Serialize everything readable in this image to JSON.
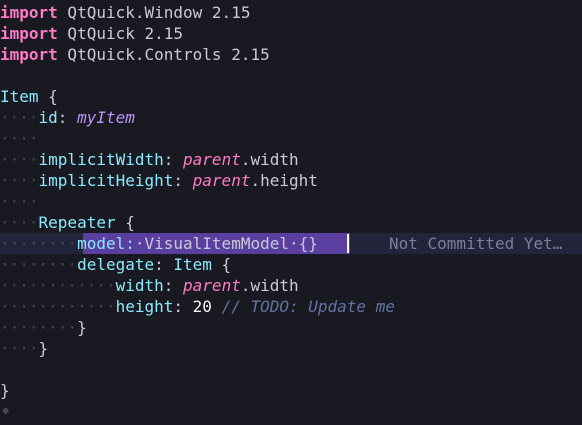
{
  "lines": [
    {
      "tokens": [
        {
          "c": "kw",
          "t": "import"
        },
        {
          "c": "plain",
          "t": " QtQuick.Window 2.15"
        }
      ]
    },
    {
      "tokens": [
        {
          "c": "kw",
          "t": "import"
        },
        {
          "c": "plain",
          "t": " QtQuick 2.15"
        }
      ]
    },
    {
      "tokens": [
        {
          "c": "kw",
          "t": "import"
        },
        {
          "c": "plain",
          "t": " QtQuick.Controls 2.15"
        }
      ]
    },
    {
      "tokens": []
    },
    {
      "tokens": [
        {
          "c": "type",
          "t": "Item"
        },
        {
          "c": "plain",
          "t": " {"
        }
      ]
    },
    {
      "tokens": [
        {
          "c": "guide-dot",
          "t": "····"
        },
        {
          "c": "prop",
          "t": "id"
        },
        {
          "c": "plain",
          "t": ": "
        },
        {
          "c": "id",
          "t": "myItem"
        }
      ]
    },
    {
      "tokens": [
        {
          "c": "guide-dot",
          "t": "····"
        }
      ]
    },
    {
      "tokens": [
        {
          "c": "guide-dot",
          "t": "····"
        },
        {
          "c": "prop",
          "t": "implicitWidth"
        },
        {
          "c": "plain",
          "t": ": "
        },
        {
          "c": "val",
          "t": "parent"
        },
        {
          "c": "plain",
          "t": ".width"
        }
      ]
    },
    {
      "tokens": [
        {
          "c": "guide-dot",
          "t": "····"
        },
        {
          "c": "prop",
          "t": "implicitHeight"
        },
        {
          "c": "plain",
          "t": ": "
        },
        {
          "c": "val",
          "t": "parent"
        },
        {
          "c": "plain",
          "t": ".height"
        }
      ]
    },
    {
      "tokens": [
        {
          "c": "guide-dot",
          "t": "····"
        }
      ]
    },
    {
      "tokens": [
        {
          "c": "guide-dot",
          "t": "····"
        },
        {
          "c": "type",
          "t": "Repeater"
        },
        {
          "c": "plain",
          "t": " {"
        }
      ]
    },
    {
      "tokens": [
        {
          "c": "guide-dot",
          "t": "········"
        },
        {
          "c": "prop",
          "t": "model:"
        },
        {
          "c": "plain",
          "t": "·VisualItemModel·{}"
        }
      ]
    },
    {
      "tokens": [
        {
          "c": "guide-dot",
          "t": "········"
        },
        {
          "c": "prop",
          "t": "delegate"
        },
        {
          "c": "plain",
          "t": ": "
        },
        {
          "c": "type",
          "t": "Item"
        },
        {
          "c": "plain",
          "t": " {"
        }
      ]
    },
    {
      "tokens": [
        {
          "c": "guide-dot",
          "t": "············"
        },
        {
          "c": "prop",
          "t": "width"
        },
        {
          "c": "plain",
          "t": ": "
        },
        {
          "c": "val",
          "t": "parent"
        },
        {
          "c": "plain",
          "t": ".width"
        }
      ]
    },
    {
      "tokens": [
        {
          "c": "guide-dot",
          "t": "············"
        },
        {
          "c": "prop",
          "t": "height"
        },
        {
          "c": "plain",
          "t": ": "
        },
        {
          "c": "num",
          "t": "20"
        },
        {
          "c": "plain",
          "t": " "
        },
        {
          "c": "comment",
          "t": "// TODO: Update me"
        }
      ]
    },
    {
      "tokens": [
        {
          "c": "guide-dot",
          "t": "········"
        },
        {
          "c": "plain",
          "t": "}"
        }
      ]
    },
    {
      "tokens": [
        {
          "c": "guide-dot",
          "t": "····"
        },
        {
          "c": "plain",
          "t": "}"
        }
      ]
    },
    {
      "tokens": []
    },
    {
      "tokens": [
        {
          "c": "plain",
          "t": "}"
        }
      ]
    }
  ],
  "blame_text": "Not Committed Yet…",
  "gutter_marker": "◆"
}
